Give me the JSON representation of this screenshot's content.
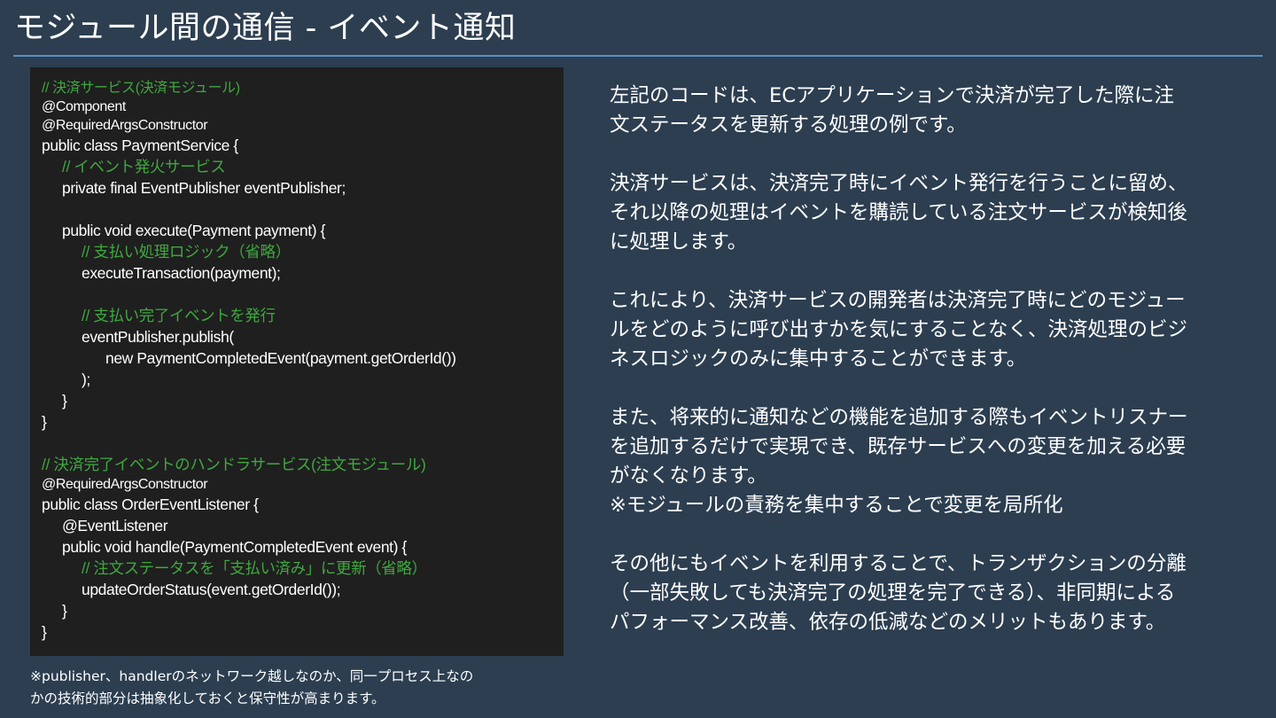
{
  "title": "モジュール間の通信 - イベント通知",
  "code_lines": [
    {
      "text": "// 決済サービス(決済モジュール)",
      "kind": "comment",
      "indent": 0,
      "size": "sm"
    },
    {
      "text": "@Component",
      "kind": "code",
      "indent": 0,
      "size": "sm"
    },
    {
      "text": "@RequiredArgsConstructor",
      "kind": "code",
      "indent": 0,
      "size": "sm"
    },
    {
      "text": "public class PaymentService {",
      "kind": "code",
      "indent": 0,
      "size": "md"
    },
    {
      "text": "// イベント発火サービス",
      "kind": "comment",
      "indent": 1,
      "size": "md"
    },
    {
      "text": "private final EventPublisher eventPublisher;",
      "kind": "code",
      "indent": 1,
      "size": "md"
    },
    {
      "text": "",
      "kind": "blank",
      "indent": 0,
      "size": "md"
    },
    {
      "text": "public void execute(Payment payment) {",
      "kind": "code",
      "indent": 1,
      "size": "md"
    },
    {
      "text": "// 支払い処理ロジック（省略）",
      "kind": "comment",
      "indent": 2,
      "size": "md"
    },
    {
      "text": "executeTransaction(payment);",
      "kind": "code",
      "indent": 2,
      "size": "md"
    },
    {
      "text": "",
      "kind": "blank",
      "indent": 0,
      "size": "md"
    },
    {
      "text": "// 支払い完了イベントを発行",
      "kind": "comment",
      "indent": 2,
      "size": "md"
    },
    {
      "text": "eventPublisher.publish(",
      "kind": "code",
      "indent": 2,
      "size": "md"
    },
    {
      "text": "new PaymentCompletedEvent(payment.getOrderId())",
      "kind": "code",
      "indent": 3,
      "size": "md"
    },
    {
      "text": ");",
      "kind": "code",
      "indent": 2,
      "size": "md"
    },
    {
      "text": "}",
      "kind": "code",
      "indent": 1,
      "size": "md"
    },
    {
      "text": "}",
      "kind": "code",
      "indent": 0,
      "size": "md"
    },
    {
      "text": "",
      "kind": "blank",
      "indent": 0,
      "size": "md"
    },
    {
      "text": "// 決済完了イベントのハンドラサービス(注文モジュール)",
      "kind": "comment",
      "indent": 0,
      "size": "md"
    },
    {
      "text": "@RequiredArgsConstructor",
      "kind": "code",
      "indent": 0,
      "size": "sm"
    },
    {
      "text": "public class OrderEventListener {",
      "kind": "code",
      "indent": 0,
      "size": "md"
    },
    {
      "text": "@EventListener",
      "kind": "code",
      "indent": 1,
      "size": "md"
    },
    {
      "text": "public void handle(PaymentCompletedEvent event) {",
      "kind": "code",
      "indent": 1,
      "size": "md"
    },
    {
      "text": "// 注文ステータスを「支払い済み」に更新（省略）",
      "kind": "comment",
      "indent": 2,
      "size": "md"
    },
    {
      "text": "updateOrderStatus(event.getOrderId());",
      "kind": "code",
      "indent": 2,
      "size": "md"
    },
    {
      "text": "}",
      "kind": "code",
      "indent": 1,
      "size": "md"
    },
    {
      "text": "}",
      "kind": "code",
      "indent": 0,
      "size": "md"
    }
  ],
  "footnote": [
    "※publisher、handlerのネットワーク越しなのか、同一プロセス上なの",
    "かの技術的部分は抽象化しておくと保守性が高まります。"
  ],
  "explanation_lines": [
    "左記のコードは、ECアプリケーションで決済が完了した際に注",
    "文ステータスを更新する処理の例です。",
    "",
    "決済サービスは、決済完了時にイベント発行を行うことに留め、",
    "それ以降の処理はイベントを購読している注文サービスが検知後",
    "に処理します。",
    "",
    "これにより、決済サービスの開発者は決済完了時にどのモジュー",
    "ルをどのように呼び出すかを気にすることなく、決済処理のビジ",
    "ネスロジックのみに集中することができます。",
    "",
    "また、将来的に通知などの機能を追加する際もイベントリスナー",
    "を追加するだけで実現でき、既存サービスへの変更を加える必要",
    "がなくなります。",
    "※モジュールの責務を集中することで変更を局所化",
    "",
    "その他にもイベントを利用することで、トランザクションの分離",
    "（一部失敗しても決済完了の処理を完了できる）、非同期による",
    "パフォーマンス改善、依存の低減などのメリットもあります。"
  ],
  "colors": {
    "background": "#2c3e50",
    "code_background": "#1f1f1f",
    "comment": "#3fa83f",
    "rule": "#5a8fc4"
  }
}
